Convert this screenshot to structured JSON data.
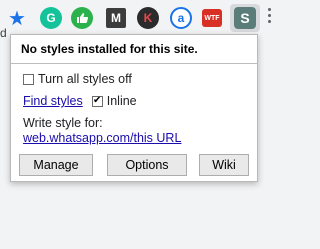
{
  "toolbar": {
    "address_fragment": "d",
    "extensions": [
      {
        "name": "grammarly-icon",
        "glyph": "G",
        "color": "#15c39a"
      },
      {
        "name": "thumbs-up-icon",
        "glyph": "👍",
        "color": "#2bb24c"
      },
      {
        "name": "m-extension-icon",
        "glyph": "M",
        "color": "#3c3c3c"
      },
      {
        "name": "k-extension-icon",
        "glyph": "K",
        "color": "#2b2b2b"
      },
      {
        "name": "a-extension-icon",
        "glyph": "a",
        "color": "#1a73e8"
      },
      {
        "name": "wtf-extension-icon",
        "glyph": "WTF",
        "color": "#d93025"
      }
    ],
    "active_extension_glyph": "S",
    "active_extension_color": "#5a7d7a"
  },
  "popup": {
    "header": "No styles installed for this site.",
    "turn_all_off_label": "Turn all styles off",
    "turn_all_off_checked": false,
    "find_styles_label": "Find styles",
    "inline_label": "Inline",
    "inline_checked": true,
    "write_style_label": "Write style for:",
    "write_style_link": "web.whatsapp.com/this URL",
    "buttons": {
      "manage": "Manage",
      "options": "Options",
      "wiki": "Wiki"
    }
  }
}
